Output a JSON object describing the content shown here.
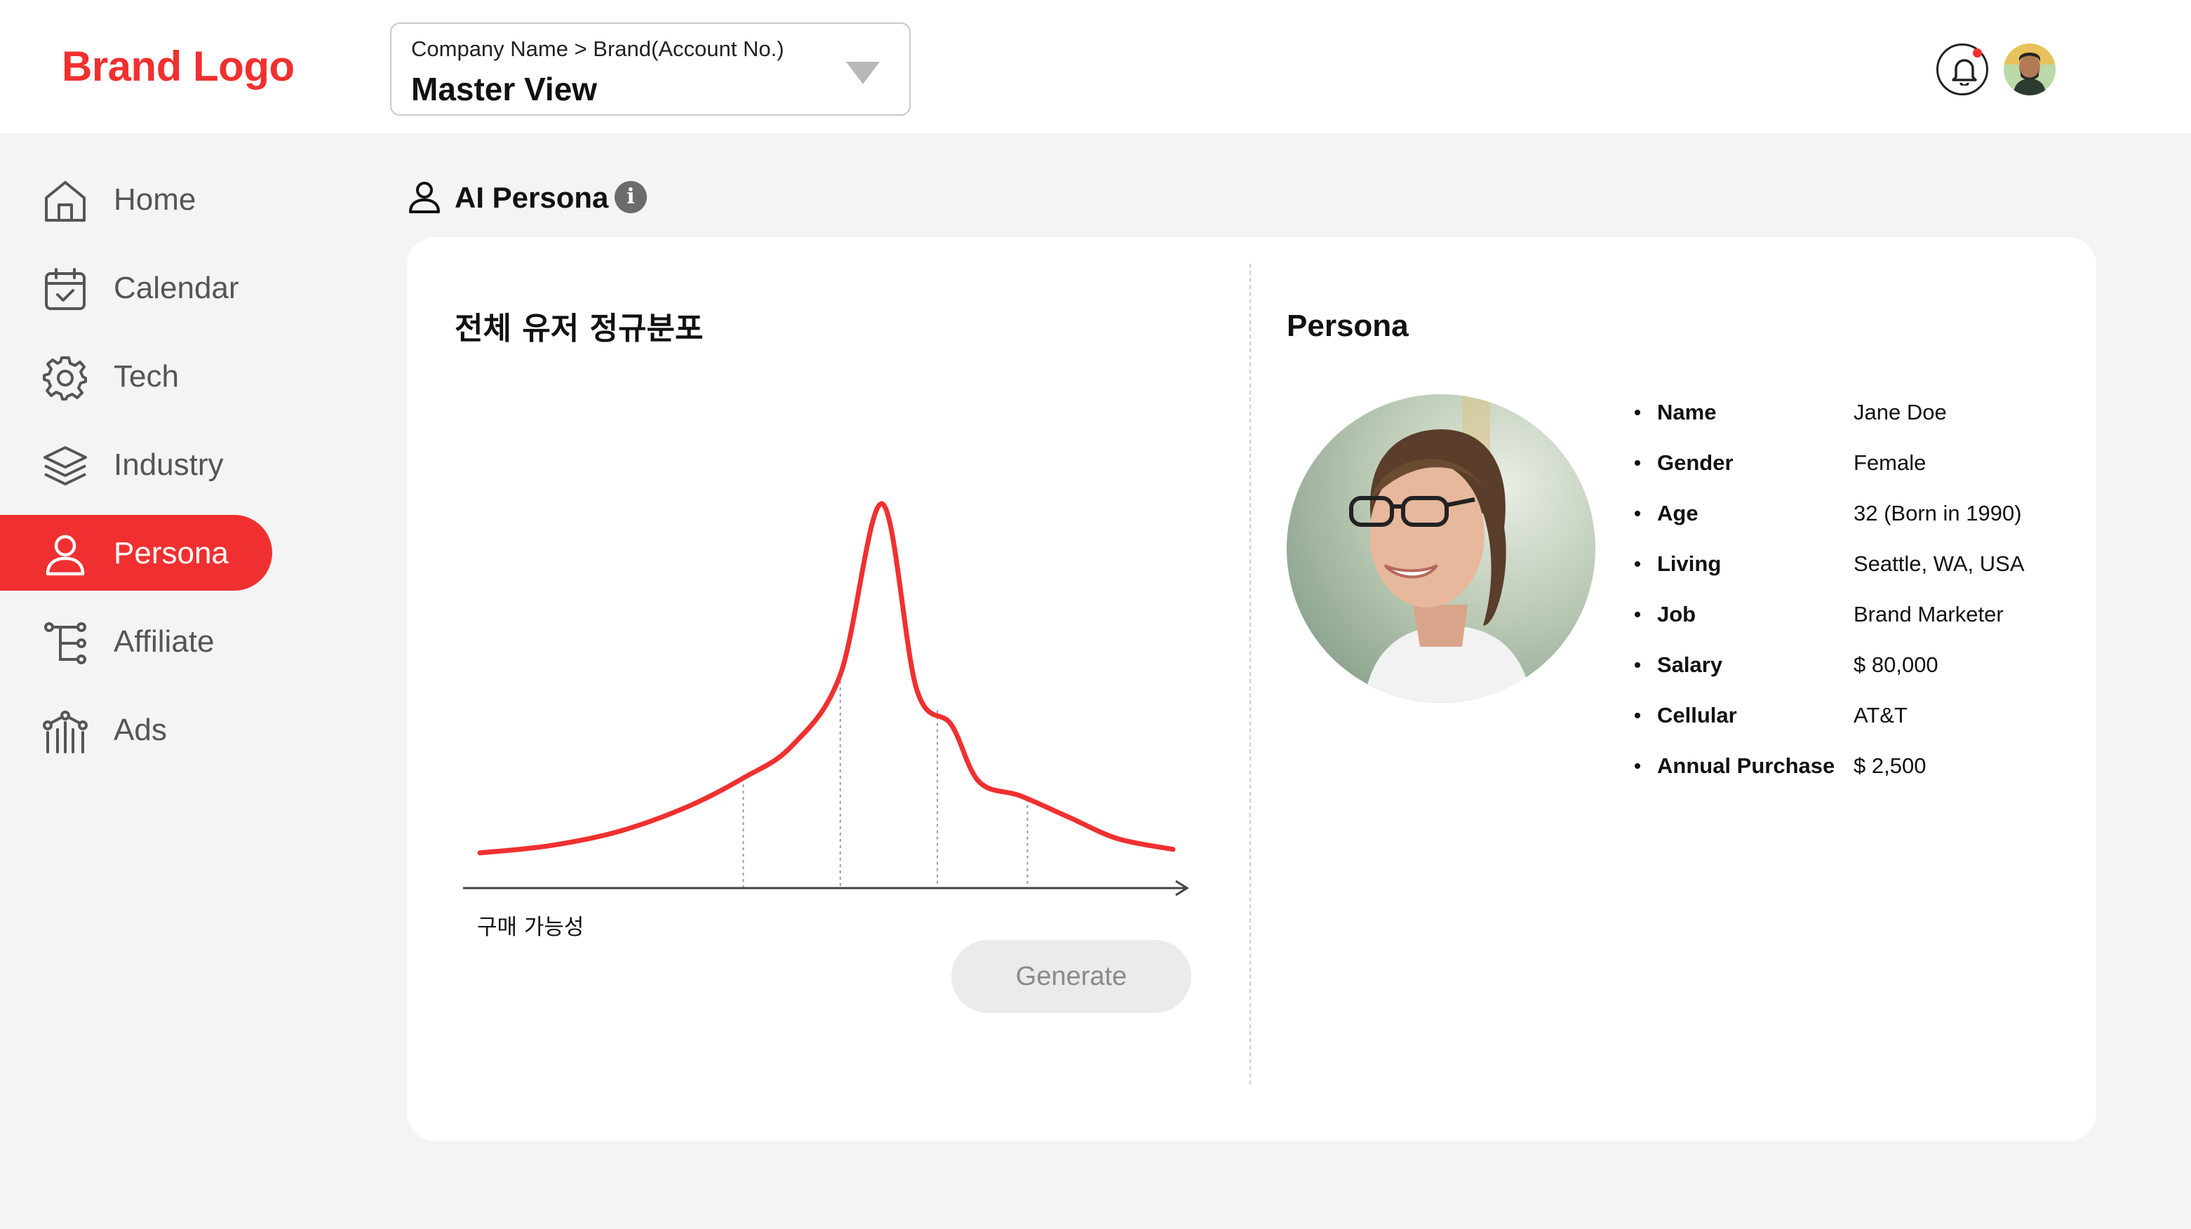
{
  "header": {
    "brand": "Brand Logo",
    "account_crumb": "Company Name > Brand(Account No.)",
    "account_view": "Master View"
  },
  "sidebar": {
    "items": [
      {
        "label": "Home",
        "icon": "home-icon"
      },
      {
        "label": "Calendar",
        "icon": "calendar-icon"
      },
      {
        "label": "Tech",
        "icon": "gear-icon"
      },
      {
        "label": "Industry",
        "icon": "layers-icon"
      },
      {
        "label": "Persona",
        "icon": "user-icon",
        "active": true
      },
      {
        "label": "Affiliate",
        "icon": "hierarchy-icon"
      },
      {
        "label": "Ads",
        "icon": "ads-icon"
      }
    ]
  },
  "section": {
    "title": "AI Persona",
    "info_glyph": "i"
  },
  "chart_panel": {
    "title": "전체 유저 정규분포",
    "generate_label": "Generate"
  },
  "chart_data": {
    "type": "line",
    "title": "전체 유저 정규분포",
    "xlabel": "구매 가능성",
    "ylabel": "",
    "grid": false,
    "legend": "none",
    "accent_color": "#f03030",
    "series": [
      {
        "x": [
          0.0,
          0.1,
          0.2,
          0.3,
          0.38,
          0.45,
          0.52,
          0.58,
          0.63,
          0.68,
          0.72,
          0.78,
          0.85,
          0.92,
          1.0
        ],
        "y": [
          0.02,
          0.04,
          0.08,
          0.15,
          0.23,
          0.32,
          0.52,
          1.0,
          0.48,
          0.38,
          0.22,
          0.18,
          0.12,
          0.06,
          0.03
        ]
      }
    ],
    "markers": [
      0.38,
      0.52,
      0.66,
      0.79
    ]
  },
  "persona": {
    "title": "Persona",
    "attributes": [
      {
        "key": "Name",
        "value": "Jane Doe"
      },
      {
        "key": "Gender",
        "value": "Female"
      },
      {
        "key": "Age",
        "value": "32 (Born in 1990)"
      },
      {
        "key": "Living",
        "value": "Seattle, WA, USA"
      },
      {
        "key": "Job",
        "value": "Brand Marketer"
      },
      {
        "key": "Salary",
        "value": "$ 80,000"
      },
      {
        "key": "Cellular",
        "value": "AT&T"
      },
      {
        "key": "Annual Purchase",
        "value": "$ 2,500"
      }
    ]
  },
  "colors": {
    "accent": "#f03030",
    "background": "#f4f4f4",
    "card": "#ffffff"
  }
}
